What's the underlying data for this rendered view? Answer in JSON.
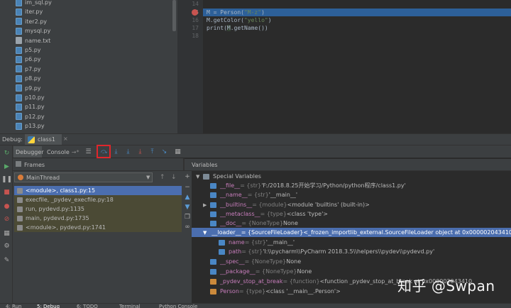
{
  "project_files": [
    {
      "name": "im_sql.py",
      "type": "py"
    },
    {
      "name": "iter.py",
      "type": "py"
    },
    {
      "name": "iter2.py",
      "type": "py"
    },
    {
      "name": "mysql.py",
      "type": "py"
    },
    {
      "name": "name.txt",
      "type": "txt"
    },
    {
      "name": "p5.py",
      "type": "py"
    },
    {
      "name": "p6.py",
      "type": "py"
    },
    {
      "name": "p7.py",
      "type": "py"
    },
    {
      "name": "p8.py",
      "type": "py"
    },
    {
      "name": "p9.py",
      "type": "py"
    },
    {
      "name": "p10.py",
      "type": "py"
    },
    {
      "name": "p11.py",
      "type": "py"
    },
    {
      "name": "p12.py",
      "type": "py"
    },
    {
      "name": "p13.py",
      "type": "py"
    }
  ],
  "editor": {
    "line_numbers": [
      "14",
      "15",
      "16",
      "17",
      "18"
    ],
    "code": {
      "l15_a": "M = Person(",
      "l15_str": "\"M-z\"",
      "l15_b": ")",
      "l16_a": "M.getColor(",
      "l16_str": "\"yello\"",
      "l16_b": ")",
      "l17_a": "print(",
      "l17_var": "M",
      "l17_b": ".getName())"
    }
  },
  "debug": {
    "label": "Debug:",
    "tab": "class1",
    "close": "×",
    "tabs": {
      "debugger": "Debugger",
      "console": "Console",
      "console_arrow": "→*"
    },
    "toolbar_icons": [
      "list-icon",
      "step-over-icon",
      "step-into-icon",
      "step-into-my-code-icon",
      "force-step-into-icon",
      "step-out-icon",
      "run-to-cursor-icon",
      "evaluate-icon"
    ],
    "frames": {
      "title": "Frames",
      "thread": "MainThread",
      "rows": [
        {
          "text": "<module>, class1.py:15",
          "state": "selected"
        },
        {
          "text": "execfile, _pydev_execfile.py:18",
          "state": "lib"
        },
        {
          "text": "run, pydevd.py:1135",
          "state": "lib"
        },
        {
          "text": "main, pydevd.py:1735",
          "state": "lib"
        },
        {
          "text": "<module>, pydevd.py:1741",
          "state": "lib"
        }
      ]
    },
    "variables": {
      "title": "Variables",
      "special_label": "Special Variables",
      "rows": {
        "file": {
          "name": "__file__",
          "type": " = {str} ",
          "value": "'F:/2018.8.25开始学习/Python/python程序/class1.py'"
        },
        "name": {
          "name": "__name__",
          "type": " = {str} ",
          "value": "'__main__'"
        },
        "builtins": {
          "name": "__builtins__",
          "type": " = {module} ",
          "value": "<module 'builtins' (built-in)>"
        },
        "metaclass": {
          "name": "__metaclass__",
          "type": " = {type} ",
          "value": "<class 'type'>"
        },
        "doc": {
          "name": "__doc__",
          "type": " = {NoneType} ",
          "value": "None"
        },
        "loader": {
          "name": "__loader__",
          "type": " = {SourceFileLoader} ",
          "value": "<_frozen_importlib_external.SourceFileLoader object at 0x000002043410A240>"
        },
        "loader_name": {
          "name": "name",
          "type": " = {str} ",
          "value": "'__main__'"
        },
        "loader_path": {
          "name": "path",
          "type": " = {str} ",
          "value": "'I:\\\\pycharm\\\\PyCharm 2018.3.5\\\\helpers\\\\pydev\\\\pydevd.py'"
        },
        "spec": {
          "name": "__spec__",
          "type": " = {NoneType} ",
          "value": "None"
        },
        "package": {
          "name": "__package__",
          "type": " = {NoneType} ",
          "value": "None"
        },
        "pydev_stop": {
          "name": "_pydev_stop_at_break",
          "type": " = {function} ",
          "value": "<function _pydev_stop_at_break at 0x000002043410"
        },
        "person": {
          "name": "Person",
          "type": " = {type} ",
          "value": "<class '__main__.Person'>"
        }
      }
    }
  },
  "watermark": "知乎 @Swpan",
  "status_tabs": [
    "4: Run",
    "5: Debug",
    "6: TODO",
    "Terminal",
    "Python Console"
  ]
}
